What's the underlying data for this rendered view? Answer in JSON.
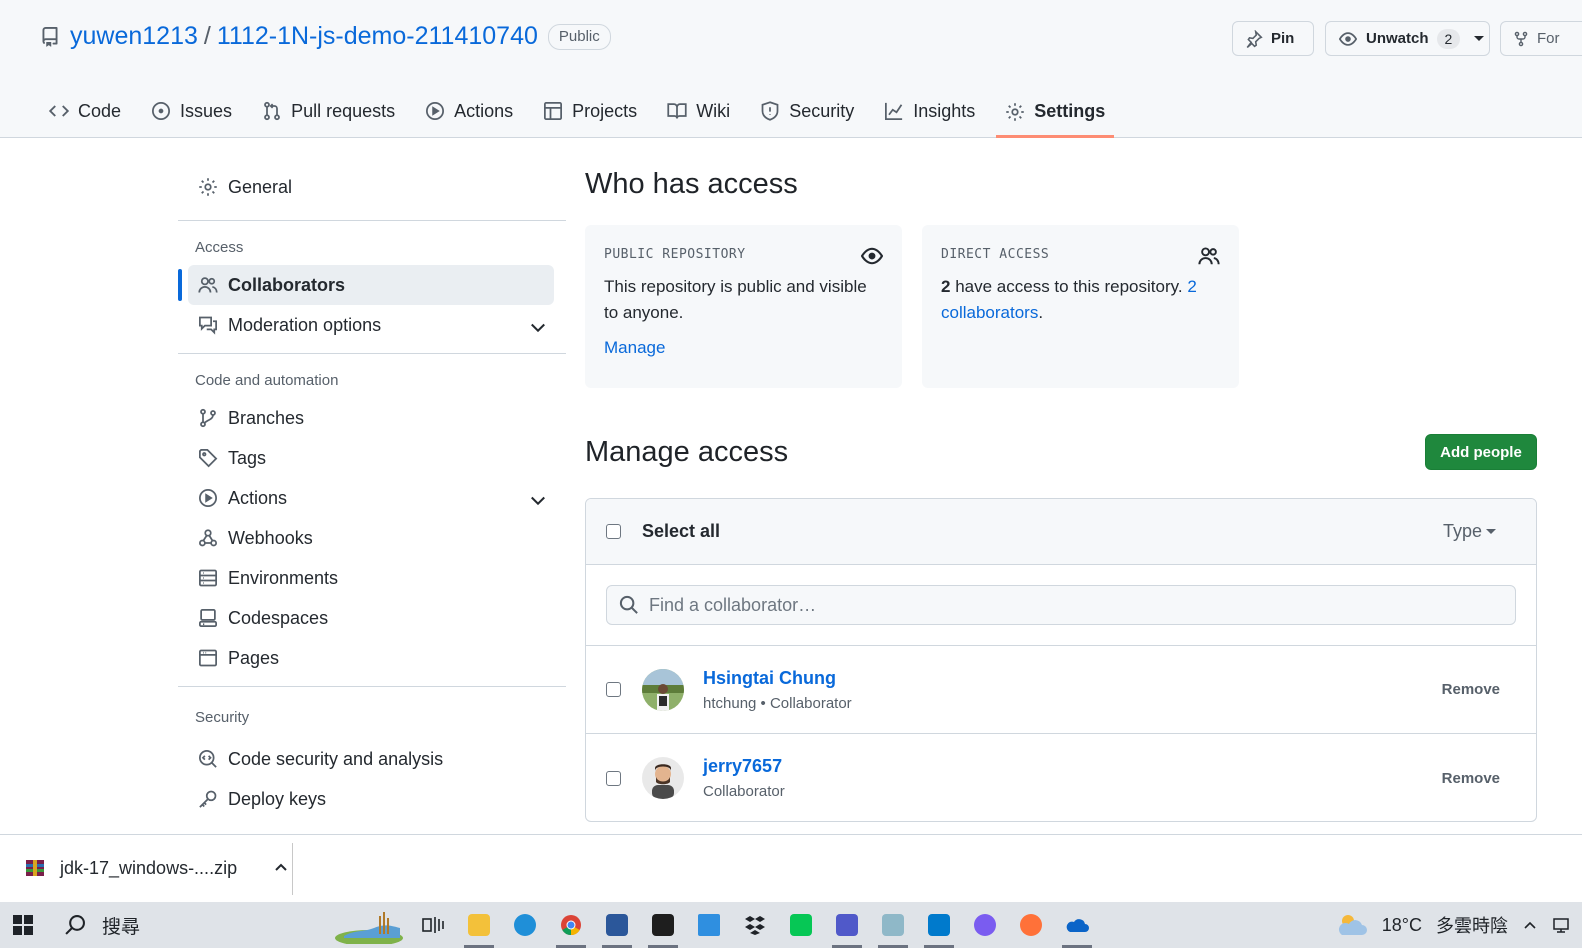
{
  "repo": {
    "owner": "yuwen1213",
    "separator": "/",
    "name": "1112-1N-js-demo-211410740",
    "visibility": "Public"
  },
  "header_buttons": {
    "pin": "Pin",
    "unwatch": "Unwatch",
    "watch_count": "2",
    "fork": "For"
  },
  "tabs": [
    {
      "label": "Code",
      "icon": "code-icon"
    },
    {
      "label": "Issues",
      "icon": "issue-icon"
    },
    {
      "label": "Pull requests",
      "icon": "pull-request-icon"
    },
    {
      "label": "Actions",
      "icon": "play-icon"
    },
    {
      "label": "Projects",
      "icon": "table-icon"
    },
    {
      "label": "Wiki",
      "icon": "book-icon"
    },
    {
      "label": "Security",
      "icon": "shield-icon"
    },
    {
      "label": "Insights",
      "icon": "graph-icon"
    },
    {
      "label": "Settings",
      "icon": "gear-icon",
      "active": true
    }
  ],
  "sidebar": {
    "general": "General",
    "access_heading": "Access",
    "collaborators": "Collaborators",
    "moderation": "Moderation options",
    "code_heading": "Code and automation",
    "branches": "Branches",
    "tags": "Tags",
    "actions": "Actions",
    "webhooks": "Webhooks",
    "environments": "Environments",
    "codespaces": "Codespaces",
    "pages": "Pages",
    "security_heading": "Security",
    "code_security": "Code security and analysis",
    "deploy_keys": "Deploy keys"
  },
  "who_has_access": {
    "title": "Who has access",
    "public_card": {
      "label": "PUBLIC REPOSITORY",
      "text": "This repository is public and visible to anyone.",
      "link": "Manage"
    },
    "direct_card": {
      "label": "DIRECT ACCESS",
      "count": "2",
      "text": " have access to this repository. ",
      "link": "2 collaborators",
      "period": "."
    }
  },
  "manage_access": {
    "title": "Manage access",
    "add_button": "Add people",
    "select_all": "Select all",
    "type_filter": "Type",
    "search_placeholder": "Find a collaborator…",
    "collaborators": [
      {
        "name": "Hsingtai Chung",
        "sub": "htchung • Collaborator",
        "action": "Remove"
      },
      {
        "name": "jerry7657",
        "sub": "Collaborator",
        "action": "Remove"
      }
    ]
  },
  "download_bar": {
    "filename": "jdk-17_windows-....zip"
  },
  "taskbar": {
    "search": "搜尋",
    "temperature": "18°C",
    "weather": "多雲時陰"
  },
  "colors": {
    "accent": "#0969da",
    "primary_button": "#1f883d",
    "active_tab_underline": "#fd8c73"
  }
}
